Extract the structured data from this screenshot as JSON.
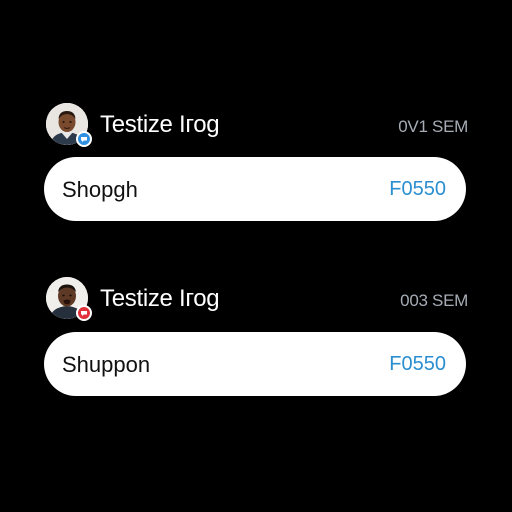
{
  "colors": {
    "background": "#000000",
    "bubble": "#ffffff",
    "accent_code": "#2a8ed0",
    "timestamp": "#a6adb5",
    "badge_blue": "#2f8fe0",
    "badge_red": "#e0303a"
  },
  "messages": [
    {
      "sender": "Testize Ігоg",
      "time": "0V1 SEM",
      "text": "Shopgh",
      "code": "F0550",
      "avatar_icon": "person-avatar-icon",
      "badge_icon": "blue-badge-icon"
    },
    {
      "sender": "Testize Ігоg",
      "time": "003 SEM",
      "text": "Shuppon",
      "code": "F0550",
      "avatar_icon": "person-avatar-icon",
      "badge_icon": "red-badge-icon"
    }
  ]
}
